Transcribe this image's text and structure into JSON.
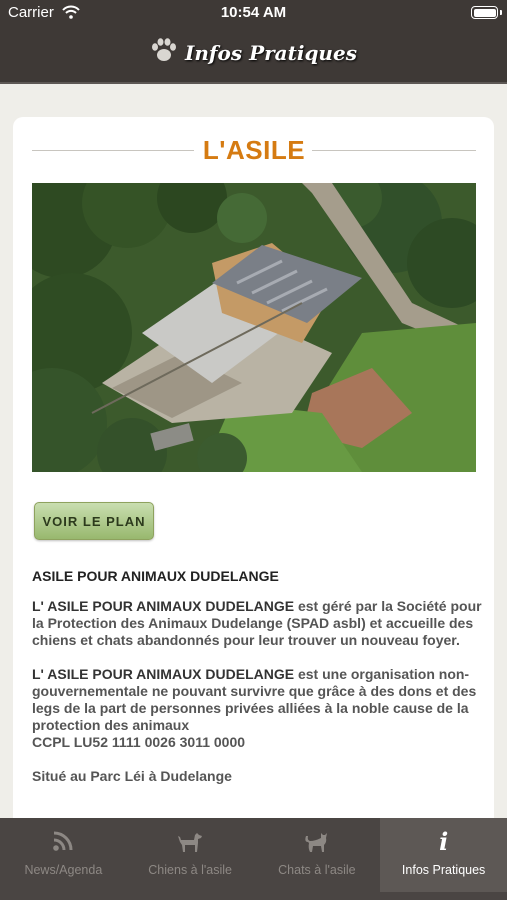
{
  "status_bar": {
    "carrier": "Carrier",
    "time": "10:54 AM",
    "wifi_icon": "wifi-icon",
    "battery_icon": "battery-icon"
  },
  "nav": {
    "title": "Infos Pratiques",
    "icon": "paw-icon"
  },
  "card": {
    "title": "L'ASILE",
    "accent_color": "#d57b12",
    "plan_button_label": "VOIR LE PLAN",
    "section_title": "ASILE POUR ANIMAUX DUDELANGE",
    "paragraph1": {
      "name": "L' ASILE POUR ANIMAUX DUDELANGE",
      "text": " est géré par la Société pour la Protection des Animaux Dudelange (SPAD asbl) et accueille des chiens et chats abandonnés pour leur trouver un nouveau foyer."
    },
    "paragraph2": {
      "name": "L' ASILE POUR ANIMAUX DUDELANGE",
      "text": " est une organisation non-gouvernementale ne pouvant survivre que grâce à des dons et des legs de la part de personnes privées alliées à la noble cause de la protection des animaux"
    },
    "ccpl": "CCPL LU52 1111 0026 3011 0000",
    "location": "Situé au Parc Léi à Dudelange"
  },
  "tabs": [
    {
      "label": "News/Agenda",
      "icon": "rss-icon",
      "active": false
    },
    {
      "label": "Chiens à l'asile",
      "icon": "dog-icon",
      "active": false
    },
    {
      "label": "Chats à l'asile",
      "icon": "cat-icon",
      "active": false
    },
    {
      "label": "Infos Pratiques",
      "icon": "info-icon",
      "active": true
    }
  ],
  "colors": {
    "bar_dark": "#3e3936",
    "tab_bg": "#4a4543",
    "tab_active_bg": "#5d5855",
    "page_bg": "#efeee9"
  }
}
